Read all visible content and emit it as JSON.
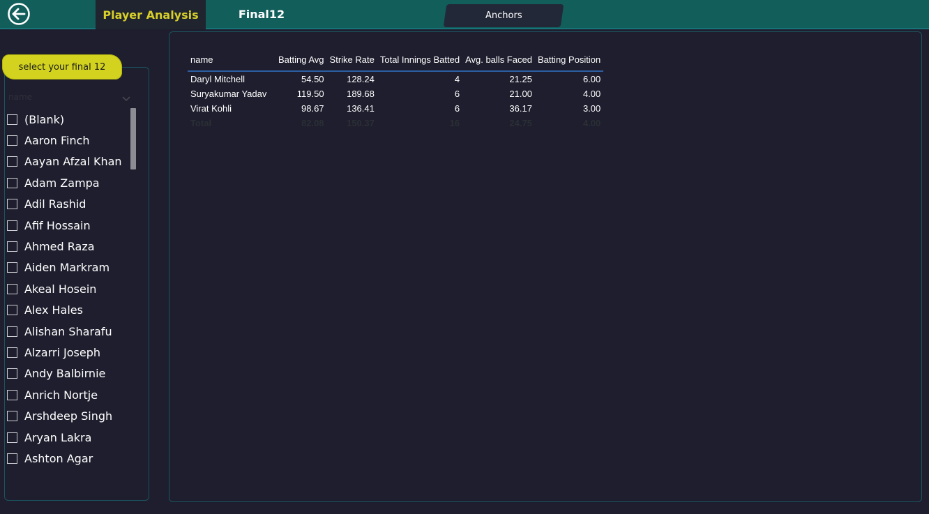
{
  "nav": {
    "tabs": [
      {
        "label": "Player Analysis",
        "active": true
      },
      {
        "label": "Final12",
        "active": false
      }
    ],
    "anchors_label": "Anchors"
  },
  "slicer": {
    "button_label": "select your final 12",
    "header": "name",
    "items": [
      "(Blank)",
      "Aaron Finch",
      "Aayan Afzal Khan",
      "Adam Zampa",
      "Adil Rashid",
      "Afif Hossain",
      "Ahmed Raza",
      "Aiden Markram",
      "Akeal Hosein",
      "Alex Hales",
      "Alishan Sharafu",
      "Alzarri Joseph",
      "Andy Balbirnie",
      "Anrich Nortje",
      "Arshdeep Singh",
      "Aryan Lakra",
      "Ashton Agar"
    ]
  },
  "table": {
    "columns": [
      "name",
      "Batting Avg",
      "Strike Rate",
      "Total Innings Batted",
      "Avg. balls Faced",
      "Batting Position"
    ],
    "rows": [
      [
        "Daryl Mitchell",
        "54.50",
        "128.24",
        "4",
        "21.25",
        "6.00"
      ],
      [
        "Suryakumar Yadav",
        "119.50",
        "189.68",
        "6",
        "21.00",
        "4.00"
      ],
      [
        "Virat Kohli",
        "98.67",
        "136.41",
        "6",
        "36.17",
        "3.00"
      ]
    ],
    "total": [
      "Total",
      "82.08",
      "150.37",
      "16",
      "24.75",
      "4.00"
    ]
  },
  "colors": {
    "topbar": "#125e5b",
    "accent_yellow": "#d3d31f",
    "background": "#1e1e2e",
    "panel_border": "#1b5560",
    "header_rule": "#2c5ea0"
  }
}
